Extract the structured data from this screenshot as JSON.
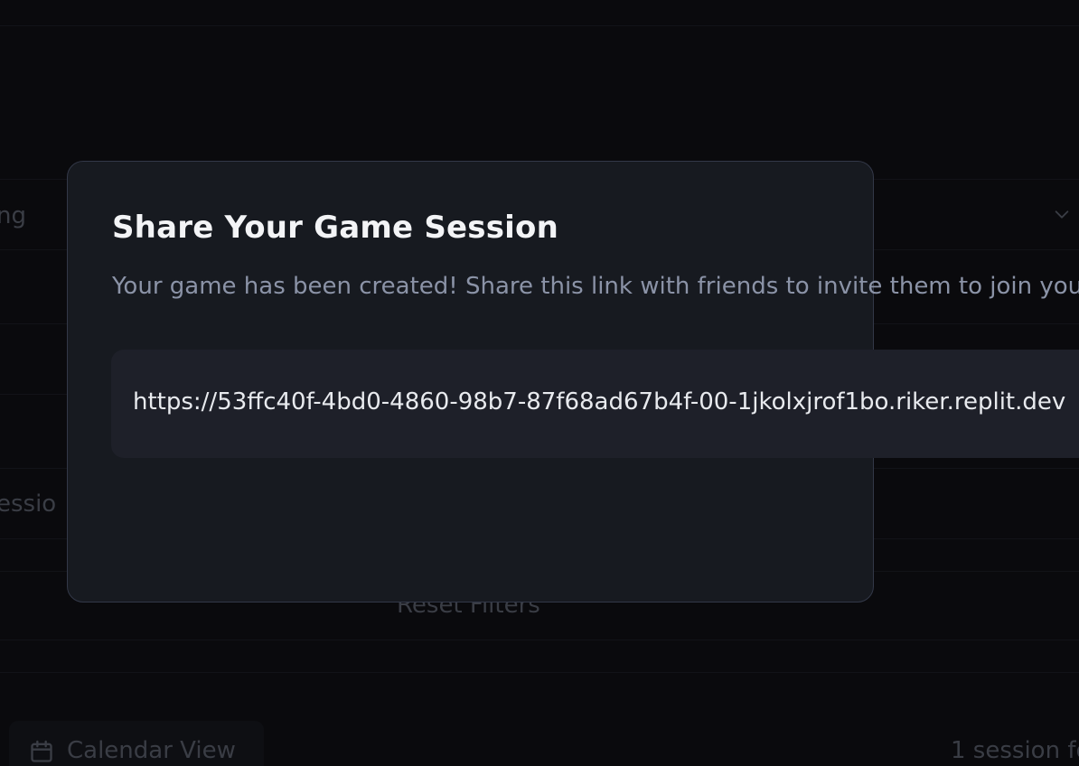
{
  "background": {
    "filter_value_fragment": "ng",
    "sessions_fragment": "essio",
    "reset_filters_label": "Reset Filters",
    "calendar_view_label": "Calendar View",
    "session_count_fragment": "1 session fo"
  },
  "modal": {
    "title": "Share Your Game Session",
    "description": "Your game has been created! Share this link with friends to invite them to join you",
    "share_link": "https://53ffc40f-4bd0-4860-98b7-87f68ad67b4f-00-1jkolxjrof1bo.riker.replit.dev"
  },
  "icons": {
    "dropdown": "chevron-down-icon",
    "calendar": "calendar-icon"
  },
  "colors": {
    "page_background": "#0a0a0d",
    "modal_background": "#171a20",
    "modal_border": "#333848",
    "link_box_background": "#1e2029",
    "title_text": "#f3f4f6",
    "description_text": "#8b93a7"
  }
}
